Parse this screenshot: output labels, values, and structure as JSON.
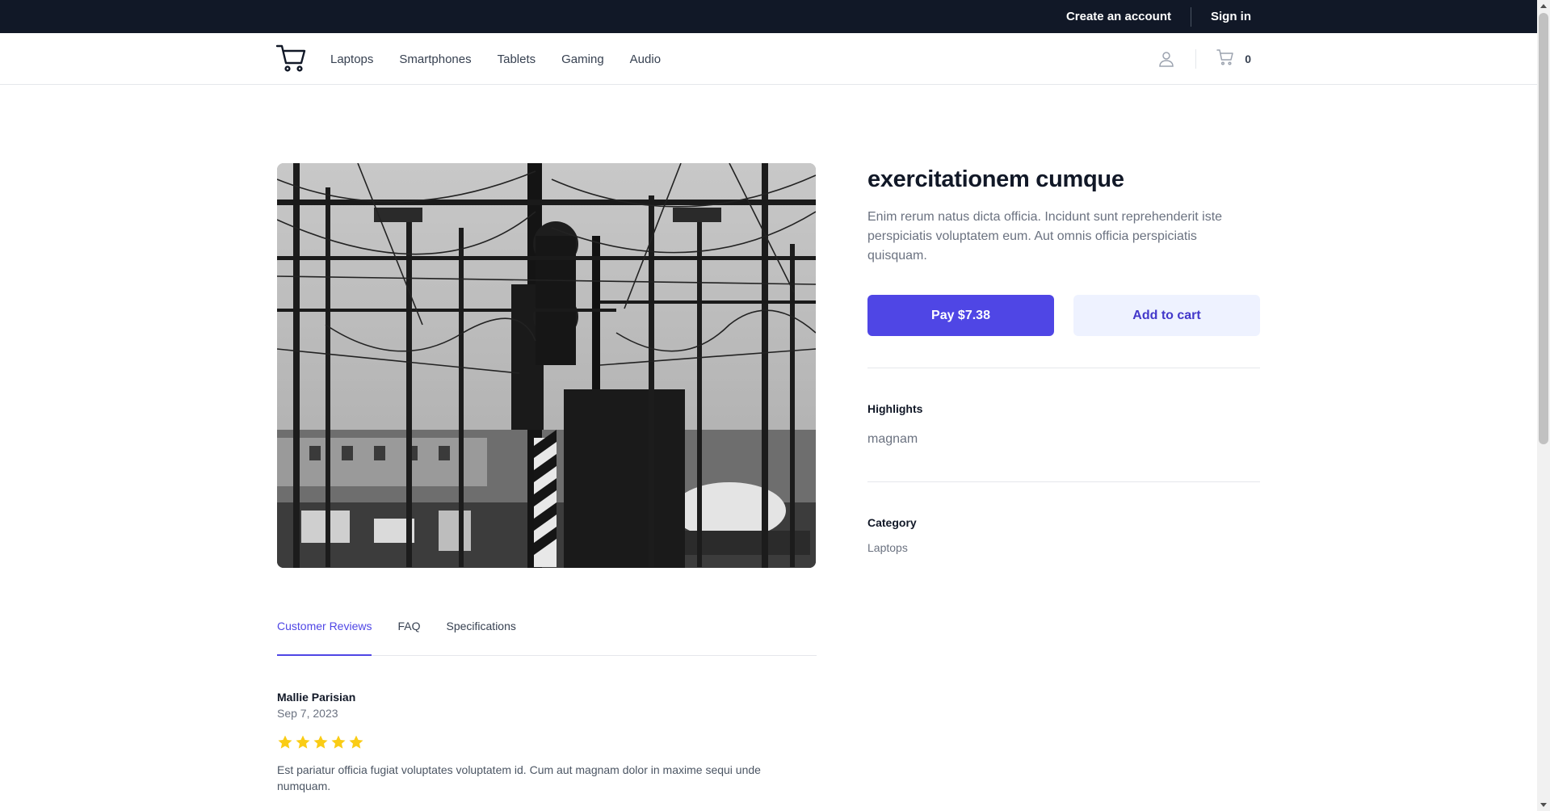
{
  "topbar": {
    "create_account": "Create an account",
    "sign_in": "Sign in"
  },
  "navbar": {
    "logo_icon": "shopping-cart-icon",
    "links": [
      "Laptops",
      "Smartphones",
      "Tablets",
      "Gaming",
      "Audio"
    ],
    "user_icon": "user-icon",
    "cart_icon": "cart-icon",
    "cart_count": "0"
  },
  "product": {
    "image_description": "grayscale-railway-overhead-wires",
    "title": "exercitationem cumque",
    "description": "Enim rerum natus dicta officia. Incidunt sunt reprehenderit iste perspiciatis voluptatem eum. Aut omnis officia perspiciatis quisquam.",
    "pay_label": "Pay $7.38",
    "add_to_cart_label": "Add to cart",
    "highlights_label": "Highlights",
    "highlights_value": "magnam",
    "category_label": "Category",
    "category_value": "Laptops"
  },
  "tabs": [
    {
      "label": "Customer Reviews",
      "active": true
    },
    {
      "label": "FAQ",
      "active": false
    },
    {
      "label": "Specifications",
      "active": false
    }
  ],
  "reviews": [
    {
      "name": "Mallie Parisian",
      "date": "Sep 7, 2023",
      "rating": 5,
      "text": "Est pariatur officia fugiat voluptates voluptatem id. Cum aut magnam dolor in maxime sequi unde numquam."
    }
  ],
  "colors": {
    "accent": "#4f46e5",
    "topbar_bg": "#111827",
    "star": "#facc15"
  }
}
